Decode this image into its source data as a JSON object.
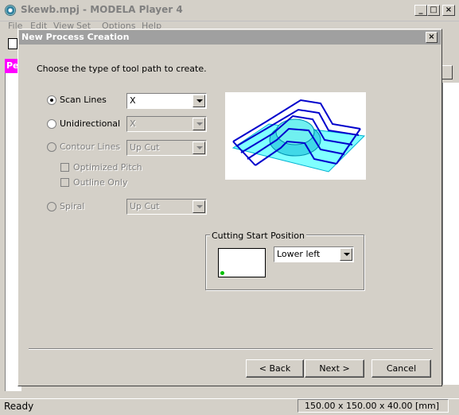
{
  "main_window": {
    "title": "Skewb.mpj - MODELA Player 4",
    "minimize": "_",
    "maximize": "□",
    "close": "×",
    "menu": [
      "File",
      "Edit",
      "View",
      "Set",
      "Options",
      "Help"
    ],
    "pink_tab_label": "Pe"
  },
  "dialog": {
    "title": "New Process Creation",
    "close": "×",
    "instruction": "Choose the type of tool path to create.",
    "path_types": {
      "scan_lines": {
        "label": "Scan Lines",
        "selected": true,
        "enabled": true,
        "combo_value": "X"
      },
      "unidirectional": {
        "label": "Unidirectional",
        "selected": false,
        "enabled": true,
        "combo_value": "X"
      },
      "contour_lines": {
        "label": "Contour Lines",
        "selected": false,
        "enabled": false,
        "combo_value": "Up Cut"
      },
      "spiral": {
        "label": "Spiral",
        "selected": false,
        "enabled": false,
        "combo_value": "Up Cut"
      }
    },
    "options": {
      "optimized_pitch": "Optimized Pitch",
      "outline_only": "Outline Only"
    },
    "cutting_start": {
      "title": "Cutting Start Position",
      "value": "Lower left"
    },
    "buttons": {
      "back": "< Back",
      "next": "Next >",
      "cancel": "Cancel"
    }
  },
  "status_bar": {
    "ready": "Ready",
    "dimensions": "150.00 x 150.00 x 40.00 [mm]"
  },
  "colors": {
    "pink_tab": "#ff00ff",
    "preview_fill": "#7fffff",
    "preview_lines": "#0000cc",
    "start_marker": "#00c000"
  }
}
